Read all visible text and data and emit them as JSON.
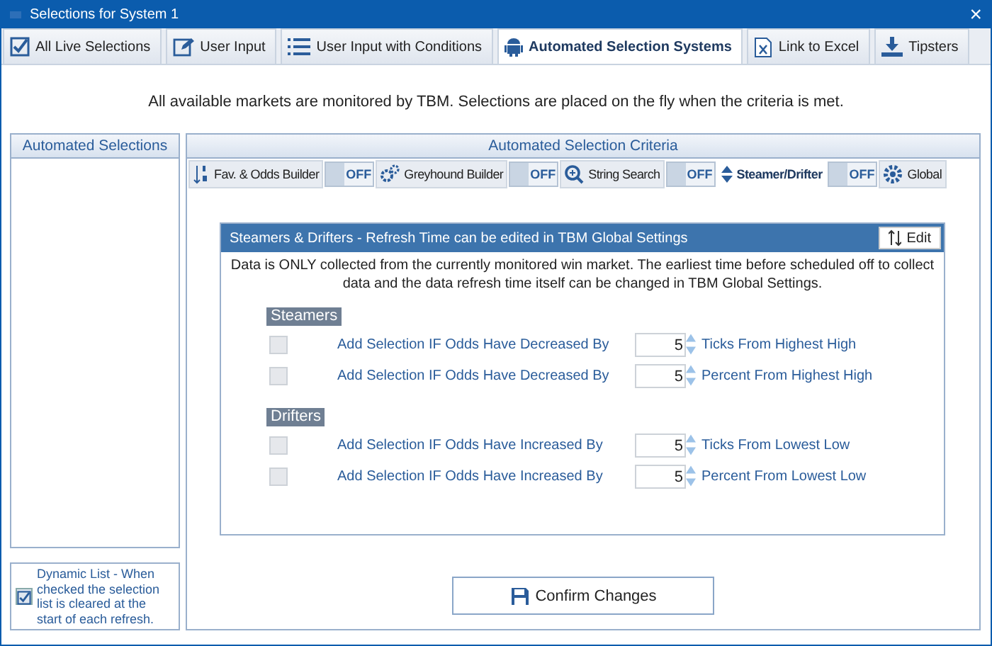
{
  "window": {
    "title": "Selections for System 1",
    "close": "×"
  },
  "tabs": [
    {
      "label": "All Live Selections",
      "selected": false
    },
    {
      "label": "User Input",
      "selected": false
    },
    {
      "label": "User Input with Conditions",
      "selected": false
    },
    {
      "label": "Automated Selection Systems",
      "selected": true
    },
    {
      "label": "Link to Excel",
      "selected": false
    },
    {
      "label": "Tipsters",
      "selected": false
    }
  ],
  "message": "All available markets are monitored by TBM. Selections are placed on the fly when the criteria is met.",
  "left_panel": {
    "title": "Automated Selections"
  },
  "dynamic_list": {
    "checked": true,
    "text": "Dynamic List - When checked the selection list is cleared at the start of each refresh."
  },
  "criteria": {
    "title": "Automated Selection Criteria",
    "subtabs": [
      {
        "label": "Fav. & Odds Builder",
        "toggle": "OFF",
        "on": false,
        "selected": false
      },
      {
        "label": "Greyhound Builder",
        "toggle": "OFF",
        "on": false,
        "selected": false
      },
      {
        "label": "String Search",
        "toggle": "OFF",
        "on": false,
        "selected": false
      },
      {
        "label": "Steamer/Drifter",
        "toggle": "OFF",
        "on": false,
        "selected": true
      },
      {
        "label": "Global",
        "selected": false
      }
    ],
    "box_title": "Steamers & Drifters - Refresh Time can be edited in TBM Global Settings",
    "edit_button": "Edit",
    "description": "Data is ONLY collected from the currently monitored win market. The earliest time before scheduled off to collect data and the data refresh time itself can be changed in TBM Global Settings.",
    "groups": [
      {
        "title": "Steamers",
        "rows": [
          {
            "checked": false,
            "label": "Add Selection IF Odds Have Decreased By",
            "value": "5",
            "unit": "Ticks From Highest High"
          },
          {
            "checked": false,
            "label": "Add Selection IF Odds Have Decreased By",
            "value": "5",
            "unit": "Percent From Highest High"
          }
        ]
      },
      {
        "title": "Drifters",
        "rows": [
          {
            "checked": false,
            "label": "Add Selection IF Odds Have Increased By",
            "value": "5",
            "unit": "Ticks From Lowest Low"
          },
          {
            "checked": false,
            "label": "Add Selection IF Odds Have Increased By",
            "value": "5",
            "unit": "Percent From Lowest Low"
          }
        ]
      }
    ],
    "confirm_button": "Confirm Changes"
  }
}
